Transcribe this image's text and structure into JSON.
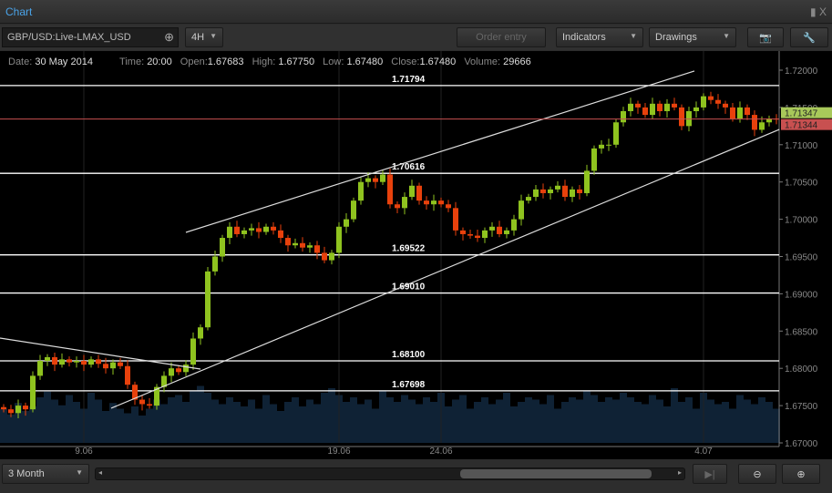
{
  "window": {
    "title": "Chart",
    "close": "X"
  },
  "toolbar": {
    "symbol": "GBP/USD:Live-LMAX_USD",
    "timeframe": "4H",
    "order_entry": "Order entry",
    "indicators": "Indicators",
    "drawings": "Drawings"
  },
  "info": {
    "date_label": "Date:",
    "date": "30 May 2014",
    "time_label": "Time:",
    "time": "20:00",
    "open_label": "Open:",
    "open": "1.67683",
    "high_label": "High:",
    "high": "1.67750",
    "low_label": "Low:",
    "low": "1.67480",
    "close_label": "Close:",
    "close": "1.67480",
    "volume_label": "Volume:",
    "volume": "29666"
  },
  "bottom": {
    "range": "3 Month"
  },
  "colors": {
    "up": "#8fc31f",
    "down": "#e8410c",
    "bid": "#a8c85a",
    "ask": "#c85050",
    "volume": "#0f2235"
  },
  "chart_data": {
    "type": "candlestick",
    "ylim": [
      1.67,
      1.72
    ],
    "yticks": [
      "1.72000",
      "1.71500",
      "1.71000",
      "1.70500",
      "1.70000",
      "1.69500",
      "1.69000",
      "1.68500",
      "1.68000",
      "1.67500",
      "1.67000"
    ],
    "xticks": [
      {
        "i": 11,
        "label": "9.06"
      },
      {
        "i": 46,
        "label": "19.06"
      },
      {
        "i": 60,
        "label": "24.06"
      },
      {
        "i": 96,
        "label": "4.07"
      }
    ],
    "closes": [
      1.6745,
      1.674,
      1.675,
      1.6745,
      1.679,
      1.681,
      1.6815,
      1.6805,
      1.6812,
      1.6808,
      1.681,
      1.6805,
      1.6812,
      1.6806,
      1.68,
      1.6808,
      1.6803,
      1.6778,
      1.6758,
      1.6752,
      1.675,
      1.6775,
      1.679,
      1.68,
      1.6795,
      1.6805,
      1.684,
      1.6855,
      1.693,
      1.695,
      1.6975,
      1.699,
      1.698,
      1.6985,
      1.6988,
      1.6983,
      1.699,
      1.6985,
      1.6975,
      1.6965,
      1.6968,
      1.6962,
      1.6965,
      1.6955,
      1.6945,
      1.6955,
      1.699,
      1.7,
      1.7025,
      1.705,
      1.7055,
      1.705,
      1.706,
      1.702,
      1.7015,
      1.703,
      1.7045,
      1.7025,
      1.702,
      1.7025,
      1.702,
      1.7015,
      1.6985,
      1.698,
      1.6978,
      1.6975,
      1.6985,
      1.699,
      1.698,
      1.6985,
      1.7,
      1.7025,
      1.703,
      1.704,
      1.7035,
      1.704,
      1.7045,
      1.703,
      1.704,
      1.7035,
      1.7065,
      1.7095,
      1.71,
      1.71,
      1.713,
      1.7145,
      1.7155,
      1.715,
      1.714,
      1.7155,
      1.7145,
      1.7155,
      1.715,
      1.7125,
      1.7145,
      1.715,
      1.7165,
      1.716,
      1.7155,
      1.715,
      1.7135,
      1.715,
      1.714,
      1.712,
      1.713,
      1.7135,
      1.71344
    ],
    "volumes": [
      30,
      25,
      35,
      28,
      32,
      40,
      45,
      38,
      33,
      42,
      36,
      30,
      44,
      38,
      28,
      35,
      30,
      26,
      32,
      24,
      30,
      38,
      34,
      40,
      42,
      36,
      46,
      50,
      44,
      38,
      34,
      40,
      36,
      32,
      38,
      30,
      42,
      34,
      28,
      36,
      40,
      32,
      38,
      34,
      44,
      48,
      42,
      36,
      40,
      34,
      38,
      30,
      46,
      40,
      36,
      42,
      38,
      34,
      40,
      36,
      44,
      32,
      38,
      42,
      30,
      36,
      40,
      34,
      38,
      44,
      32,
      36,
      40,
      38,
      34,
      42,
      30,
      36,
      40,
      38,
      46,
      42,
      36,
      40,
      38,
      44,
      40,
      36,
      34,
      42,
      38,
      32,
      48,
      36,
      40,
      30,
      44,
      38,
      34,
      36,
      30,
      42,
      38,
      34,
      40,
      36,
      30
    ],
    "levels": [
      "1.71794",
      "1.70616",
      "1.69522",
      "1.69010",
      "1.68100",
      "1.67698"
    ],
    "trendlines": [
      [
        25,
        1.69824,
        94.75,
        1.71988
      ],
      [
        14.75,
        1.67465,
        106.4,
        1.71205
      ],
      [
        -0.5,
        1.68406,
        27,
        1.6799
      ]
    ],
    "bid": "1.71347",
    "ask": "1.71344"
  }
}
